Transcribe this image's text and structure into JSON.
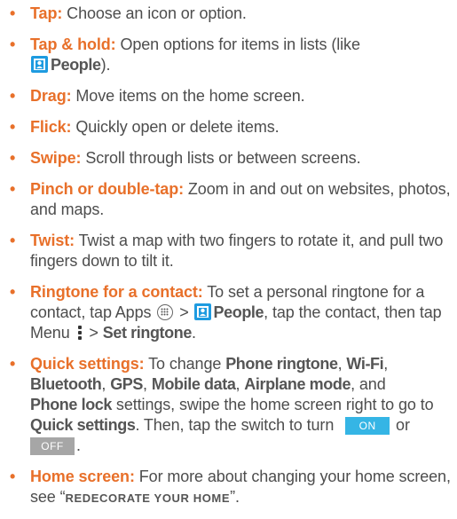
{
  "bullet_glyph": "•",
  "colors": {
    "term": "#e8702a",
    "body_text": "#4d4d4d",
    "icon_blue": "#1e9be0",
    "toggle_on": "#35b5e5",
    "toggle_off": "#a6a6a6"
  },
  "items": [
    {
      "term": "Tap:",
      "text": " Choose an icon or option."
    },
    {
      "term": "Tap & hold:",
      "text": " Open options for items in lists (like ",
      "app": "People",
      "tail": ")."
    },
    {
      "term": "Drag:",
      "text": " Move items on the home screen."
    },
    {
      "term": "Flick:",
      "text": " Quickly open or delete items."
    },
    {
      "term": "Swipe:",
      "text": " Scroll through lists or between screens."
    },
    {
      "term": "Pinch or double-tap:",
      "text": " Zoom in and out on websites, photos, and maps."
    },
    {
      "term": "Twist:",
      "text": " Twist a map with two fingers to rotate it, and pull two fingers down to tilt it."
    },
    {
      "term": "Ringtone for a contact:",
      "text1": " To set a personal ringtone for a contact, tap Apps ",
      "sep1": " > ",
      "app": "People",
      "text2": ", tap the contact, then tap Menu ",
      "sep2": " > ",
      "action": "Set ringtone",
      "end": "."
    },
    {
      "term": "Quick settings:",
      "intro": " To change ",
      "s1": "Phone ringtone",
      "s2": "Wi-Fi",
      "s3": "Bluetooth",
      "s4": "GPS",
      "s5": "Mobile data",
      "s6": "Airplane mode",
      "and": ", and",
      "s7": "Phone lock",
      "mid": " settings, swipe the home screen right to go to ",
      "qs": "Quick settings",
      "after": ". Then, tap the switch to turn ",
      "on": "ON",
      "or": " or",
      "off": "OFF",
      "end": "."
    },
    {
      "term": "Home screen:",
      "text": " For more about changing your home screen, see ",
      "open_quote": "“",
      "link": "REDECORATE YOUR HOME",
      "close_quote": "”."
    }
  ]
}
